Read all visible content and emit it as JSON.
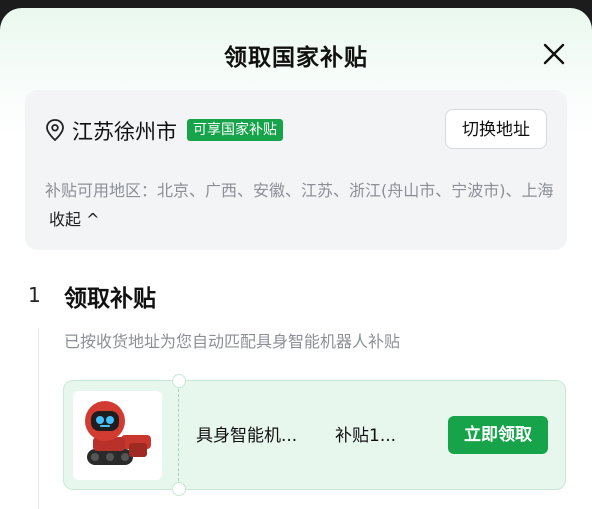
{
  "title": "领取国家补贴",
  "address": {
    "city": "江苏徐州市",
    "tag": "可享国家补贴",
    "switch_label": "切换地址",
    "areas_text": "补贴可用地区：北京、广西、安徽、江苏、浙江(舟山市、宁波市)、上海",
    "collapse_label": "收起 ^"
  },
  "step": {
    "number": "1",
    "title": "领取补贴",
    "subtitle": "已按收货地址为您自动匹配具身智能机器人补贴"
  },
  "coupon": {
    "product_name": "具身智能机...",
    "subsidy": "补贴1...",
    "claim_label": "立即领取"
  },
  "icons": {
    "close": "close-icon",
    "location": "location-pin-icon",
    "product": "robot-product-image"
  },
  "colors": {
    "accent": "#16a34a",
    "coupon_bg": "#e8f7ee"
  }
}
